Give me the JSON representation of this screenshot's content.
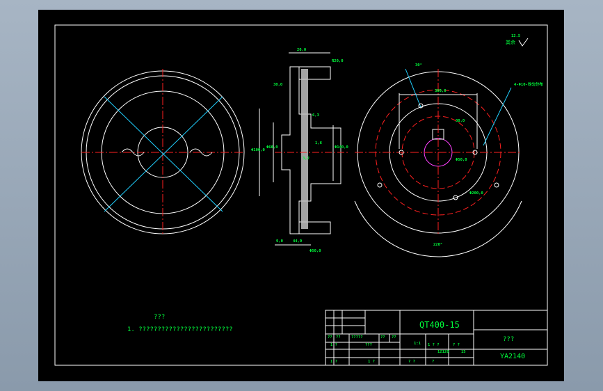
{
  "drawing": {
    "notes_title": "???",
    "notes_line": "1. ?????????????????????????",
    "roughness": "12.5",
    "roughness_label": "其余",
    "hole_note": "4-Φ10-均匀分布",
    "labels": {
      "angle_top": "30°",
      "angle_bottom": "220°",
      "dim_top_a": "20,0",
      "dim_top_b": "R20,0",
      "dim_left": "30,0",
      "dim_bottom_a": "9,0",
      "dim_bottom_b": "44,0",
      "dim_bottom_c": "Φ50,0",
      "dim_d1": "Φ100,0",
      "dim_d2": "Φ60,0",
      "dim_d3": "Φ140,0",
      "dim_right_a": "300,0",
      "dim_right_b": "Φ50,0",
      "dim_right_c": "30,0",
      "dim_pcd": "Φ200,0",
      "roughness_sm1": "6,3",
      "roughness_sm2": "1,6",
      "roughness_sm3": "3,2"
    }
  },
  "title_block": {
    "material": "QT400-15",
    "part_name": "???",
    "drawing_no": "YA2140",
    "scale_cell": "1:1",
    "qty_cell": "15",
    "weight_cell": "12120",
    "row_a": [
      "??",
      "??",
      "?????",
      "??",
      "??"
    ],
    "row_b": [
      "1 ?",
      "???",
      "1 ? ?",
      "? ?"
    ],
    "row_c": [
      "1 ?",
      "1 ?",
      "? ?",
      "?"
    ]
  }
}
